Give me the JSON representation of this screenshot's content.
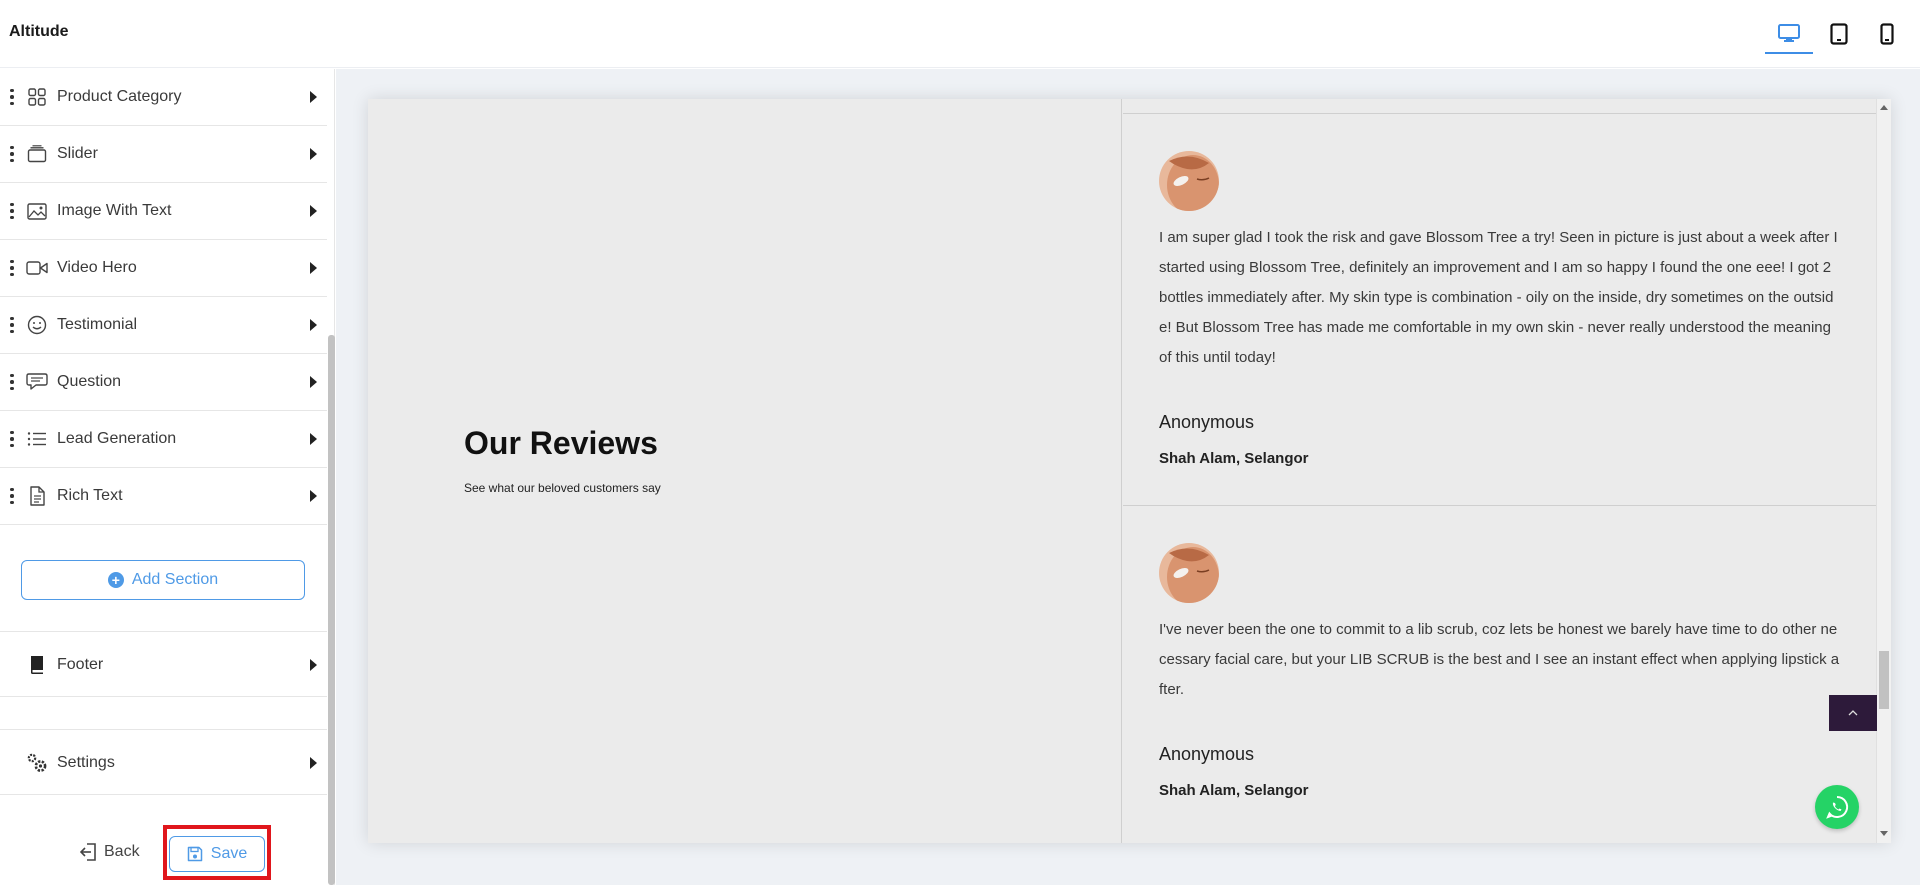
{
  "app": {
    "title": "Altitude"
  },
  "devices": [
    {
      "name": "desktop",
      "icon": "desktop-icon",
      "active": true
    },
    {
      "name": "tablet",
      "icon": "tablet-icon",
      "active": false
    },
    {
      "name": "mobile",
      "icon": "mobile-icon",
      "active": false
    }
  ],
  "sidebar": {
    "items": [
      {
        "label": "Product Category",
        "icon": "grid-icon"
      },
      {
        "label": "Slider",
        "icon": "slider-icon"
      },
      {
        "label": "Image With Text",
        "icon": "image-icon"
      },
      {
        "label": "Video Hero",
        "icon": "video-icon"
      },
      {
        "label": "Testimonial",
        "icon": "smiley-icon"
      },
      {
        "label": "Question",
        "icon": "chat-icon"
      },
      {
        "label": "Lead Generation",
        "icon": "list-icon"
      },
      {
        "label": "Rich Text",
        "icon": "document-icon"
      }
    ],
    "add_section_label": "Add Section",
    "footer_label": "Footer",
    "settings_label": "Settings",
    "back_label": "Back",
    "save_label": "Save"
  },
  "preview": {
    "title": "Our Reviews",
    "subtitle": "See what our beloved customers say",
    "reviews": [
      {
        "text": "I am super glad I took the risk and gave Blossom Tree a try! Seen in picture is just about a week after I started using Blossom Tree, definitely an improvement and I am so happy I found the one eee! I got 2 bottles immediately after. My skin type is combination - oily on the inside, dry sometimes on the outside! But Blossom Tree has made me comfortable in my own skin - never really understood the meaning of this until today!",
        "name": "Anonymous",
        "location": "Shah Alam, Selangor"
      },
      {
        "text": "I've never been the one to commit to a lib scrub, coz lets be honest we barely have time to do other necessary facial care, but your LIB SCRUB is the best and I see an instant effect when applying lipstick after.",
        "name": "Anonymous",
        "location": "Shah Alam, Selangor"
      }
    ]
  },
  "colors": {
    "accent": "#4f9ae6",
    "highlight": "#e0161c",
    "back_to_top": "#2d1a3a",
    "whatsapp": "#25d366"
  }
}
